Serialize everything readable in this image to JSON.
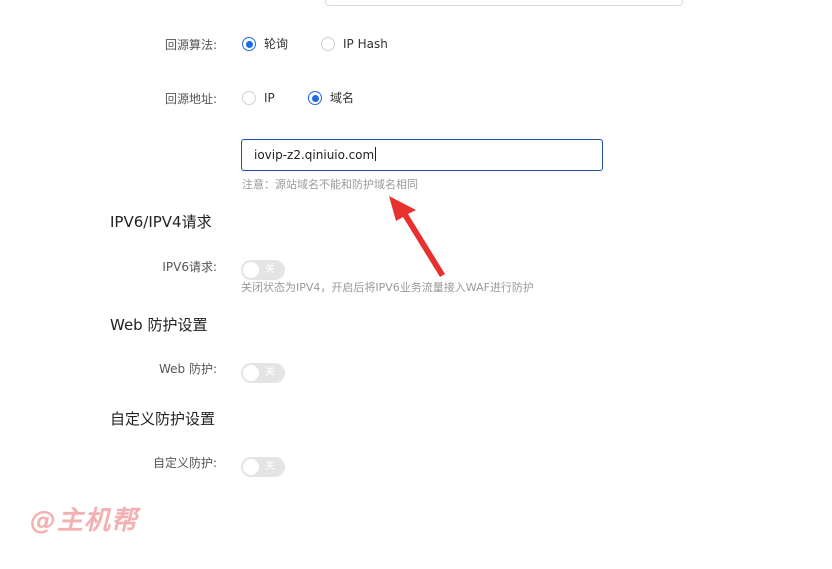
{
  "origin_algorithm": {
    "label": "回源算法:",
    "options": [
      {
        "label": "轮询",
        "checked": true
      },
      {
        "label": "IP Hash",
        "checked": false
      }
    ]
  },
  "origin_address": {
    "label": "回源地址:",
    "options": [
      {
        "label": "IP",
        "checked": false
      },
      {
        "label": "域名",
        "checked": true
      }
    ],
    "domain_value": "iovip-z2.qiniuio.com",
    "note": "注意：源站域名不能和防护域名相同"
  },
  "ipv6_section": {
    "title": "IPV6/IPV4请求",
    "label": "IPV6请求:",
    "toggle_text": "关",
    "toggle_on": false,
    "hint": "关闭状态为IPV4，开启后将IPV6业务流量接入WAF进行防护"
  },
  "web_section": {
    "title": "Web 防护设置",
    "label": "Web 防护:",
    "toggle_text": "关",
    "toggle_on": false
  },
  "custom_section": {
    "title": "自定义防护设置",
    "label": "自定义防护:",
    "toggle_text": "关",
    "toggle_on": false
  },
  "watermark": "@主机帮",
  "colors": {
    "primary": "#1d6ae8",
    "annotation_arrow": "#e8312f",
    "watermark": "#f3b0b2"
  }
}
